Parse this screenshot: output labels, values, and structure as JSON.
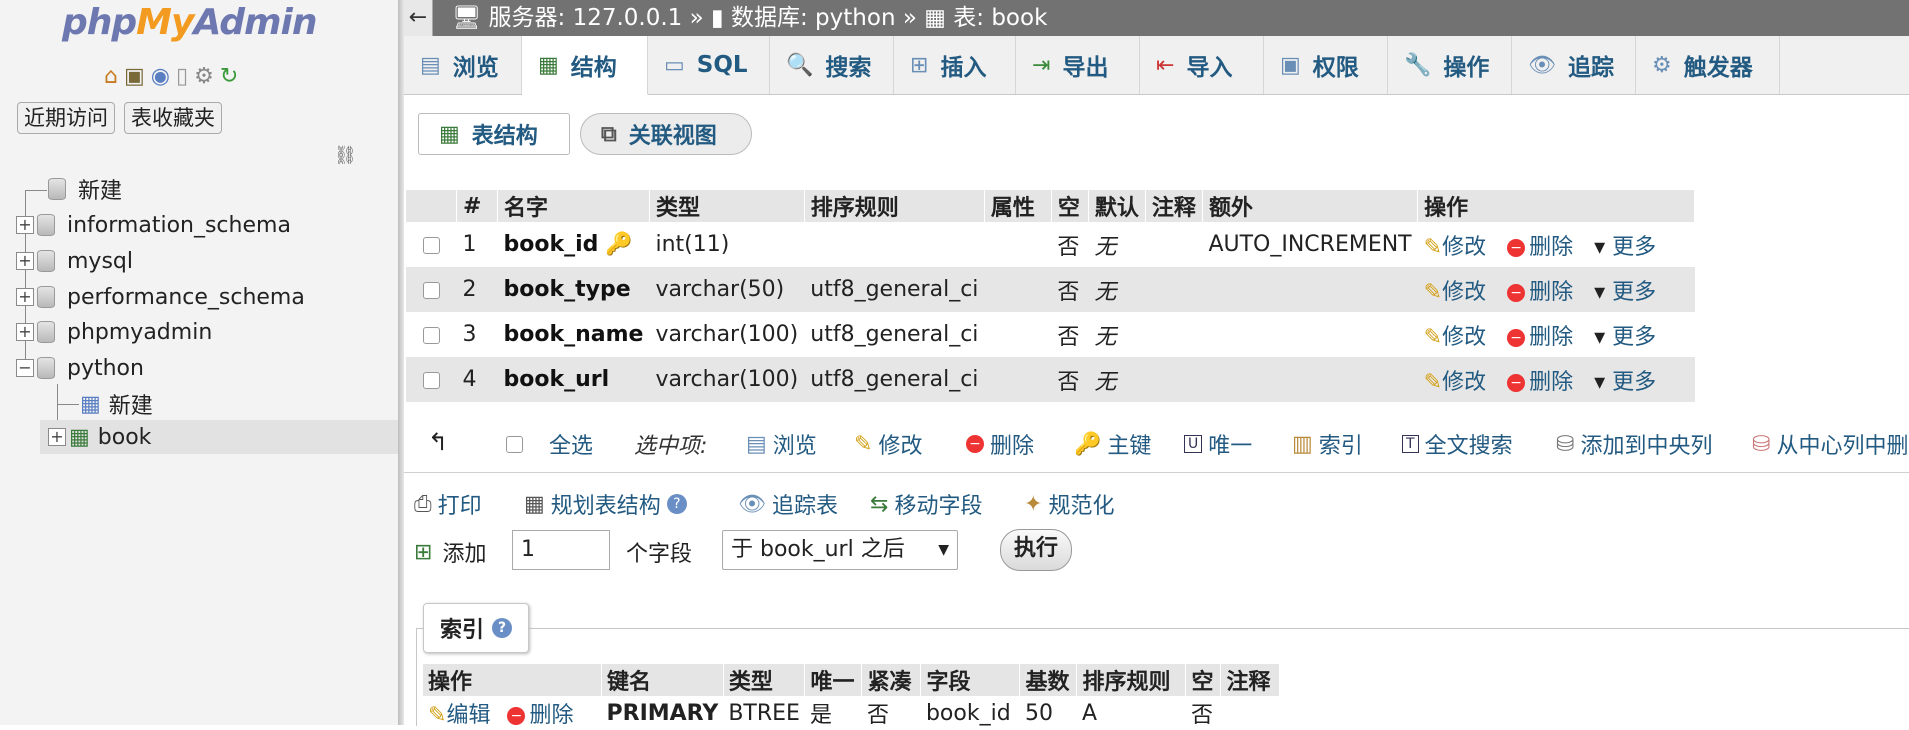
{
  "sidebar": {
    "logo": {
      "php": "php",
      "my": "My",
      "admin": "Admin"
    },
    "buttons": {
      "recent": "近期访问",
      "favorites": "表收藏夹"
    },
    "tree": [
      {
        "label": "新建"
      },
      {
        "label": "information_schema"
      },
      {
        "label": "mysql"
      },
      {
        "label": "performance_schema"
      },
      {
        "label": "phpmyadmin"
      },
      {
        "label": "python"
      },
      {
        "label": "新建"
      },
      {
        "label": "book"
      }
    ]
  },
  "breadcrumb": {
    "server": "服务器: 127.0.0.1",
    "sep": "»",
    "database": "数据库: python",
    "table": "表: book"
  },
  "tabs": [
    {
      "label": "浏览",
      "icon": "browse-icon"
    },
    {
      "label": "结构",
      "icon": "structure-icon"
    },
    {
      "label": "SQL",
      "icon": "sql-icon"
    },
    {
      "label": "搜索",
      "icon": "search-icon"
    },
    {
      "label": "插入",
      "icon": "insert-icon"
    },
    {
      "label": "导出",
      "icon": "export-icon"
    },
    {
      "label": "导入",
      "icon": "import-icon"
    },
    {
      "label": "权限",
      "icon": "privileges-icon"
    },
    {
      "label": "操作",
      "icon": "operations-icon"
    },
    {
      "label": "追踪",
      "icon": "tracking-icon"
    },
    {
      "label": "触发器",
      "icon": "triggers-icon"
    }
  ],
  "subtabs": {
    "table_structure": "表结构",
    "relation_view": "关联视图"
  },
  "columns_table": {
    "headers": [
      "#",
      "名字",
      "类型",
      "排序规则",
      "属性",
      "空",
      "默认",
      "注释",
      "额外",
      "操作"
    ],
    "rows": [
      {
        "num": "1",
        "name": "book_id",
        "type": "int(11)",
        "collation": "",
        "null": "否",
        "default": "无",
        "extra": "AUTO_INCREMENT"
      },
      {
        "num": "2",
        "name": "book_type",
        "type": "varchar(50)",
        "collation": "utf8_general_ci",
        "null": "否",
        "default": "无",
        "extra": ""
      },
      {
        "num": "3",
        "name": "book_name",
        "type": "varchar(100)",
        "collation": "utf8_general_ci",
        "null": "否",
        "default": "无",
        "extra": ""
      },
      {
        "num": "4",
        "name": "book_url",
        "type": "varchar(100)",
        "collation": "utf8_general_ci",
        "null": "否",
        "default": "无",
        "extra": ""
      }
    ],
    "actions": {
      "edit": "修改",
      "delete": "删除",
      "more": "更多"
    }
  },
  "bulk": {
    "select_all": "全选",
    "with_selected": "选中项:",
    "browse": "浏览",
    "edit": "修改",
    "delete": "删除",
    "primary": "主键",
    "unique": "唯一",
    "index": "索引",
    "fulltext": "全文搜索",
    "add_central": "添加到中央列",
    "remove_central": "从中心列中删"
  },
  "tools": {
    "print": "打印",
    "propose": "规划表结构",
    "track": "追踪表",
    "move": "移动字段",
    "normalize": "规范化"
  },
  "add_columns": {
    "label": "添加",
    "count": "1",
    "unit": "个字段",
    "position": "于 book_url 之后",
    "go": "执行"
  },
  "indexes": {
    "title": "索引",
    "headers": [
      "操作",
      "键名",
      "类型",
      "唯一",
      "紧凑",
      "字段",
      "基数",
      "排序规则",
      "空",
      "注释"
    ],
    "row": {
      "edit": "编辑",
      "delete": "删除",
      "keyname": "PRIMARY",
      "type": "BTREE",
      "unique": "是",
      "packed": "否",
      "column": "book_id",
      "cardinality": "50",
      "collation": "A",
      "null": "否",
      "comment": ""
    }
  }
}
